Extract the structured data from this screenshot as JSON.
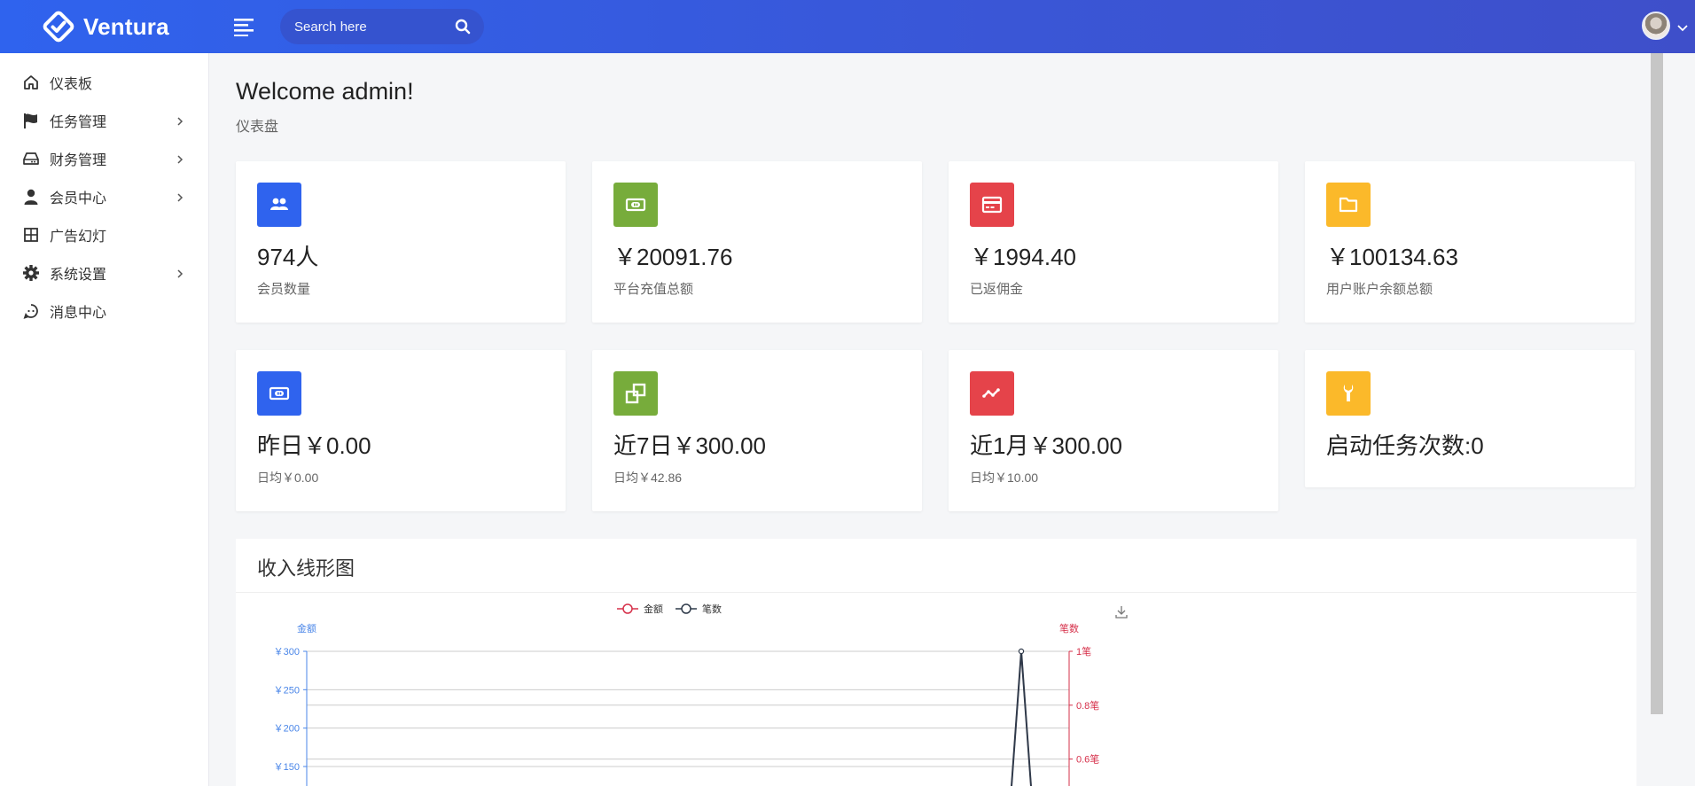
{
  "header": {
    "logo_text": "Ventura",
    "search_placeholder": "Search here"
  },
  "sidebar": {
    "items": [
      {
        "label": "仪表板",
        "icon": "home-icon",
        "has_children": false
      },
      {
        "label": "任务管理",
        "icon": "flag-icon",
        "has_children": true
      },
      {
        "label": "财务管理",
        "icon": "hdd-icon",
        "has_children": true
      },
      {
        "label": "会员中心",
        "icon": "user-icon",
        "has_children": true
      },
      {
        "label": "广告幻灯",
        "icon": "grid-icon",
        "has_children": false
      },
      {
        "label": "系统设置",
        "icon": "gear-icon",
        "has_children": true
      },
      {
        "label": "消息中心",
        "icon": "chat-icon",
        "has_children": false
      }
    ]
  },
  "page": {
    "title": "Welcome admin!",
    "subtitle": "仪表盘"
  },
  "stats_row1": [
    {
      "value": "974人",
      "label": "会员数量",
      "color": "#2f63ee",
      "icon": "users-icon"
    },
    {
      "value": "￥20091.76",
      "label": "平台充值总额",
      "color": "#77ac3b",
      "icon": "money-icon"
    },
    {
      "value": "￥1994.40",
      "label": "已返佣金",
      "color": "#e5434a",
      "icon": "credit-card-icon"
    },
    {
      "value": "￥100134.63",
      "label": "用户账户余额总额",
      "color": "#fbb92a",
      "icon": "folder-icon"
    }
  ],
  "stats_row2": [
    {
      "value": "昨日￥0.00",
      "label": "日均￥0.00",
      "color": "#2f63ee",
      "icon": "money-icon"
    },
    {
      "value": "近7日￥300.00",
      "label": "日均￥42.86",
      "color": "#77ac3b",
      "icon": "clone-icon"
    },
    {
      "value": "近1月￥300.00",
      "label": "日均￥10.00",
      "color": "#e5434a",
      "icon": "line-chart-icon"
    },
    {
      "value": "启动任务次数:0",
      "label": "",
      "color": "#fbb92a",
      "icon": "wrench-icon"
    }
  ],
  "chart": {
    "title": "收入线形图",
    "download_icon": "download-icon"
  },
  "chart_data": {
    "type": "line",
    "legend": [
      "金额",
      "笔数"
    ],
    "legend_position": "top-center",
    "y_left": {
      "label": "金额",
      "ticks": [
        "￥300",
        "￥250",
        "￥200",
        "￥150"
      ],
      "range": [
        0,
        300
      ],
      "color": "#4a86e8"
    },
    "y_right": {
      "label": "笔数",
      "ticks": [
        "1笔",
        "0.8笔",
        "0.6笔"
      ],
      "range": [
        0,
        1
      ],
      "color": "#d6304a"
    },
    "series": [
      {
        "name": "金额",
        "color": "#d6304a",
        "axis": "left",
        "peak_value": 300
      },
      {
        "name": "笔数",
        "color": "#2f3a4a",
        "axis": "right",
        "peak_value": 1
      }
    ],
    "grid": true
  }
}
